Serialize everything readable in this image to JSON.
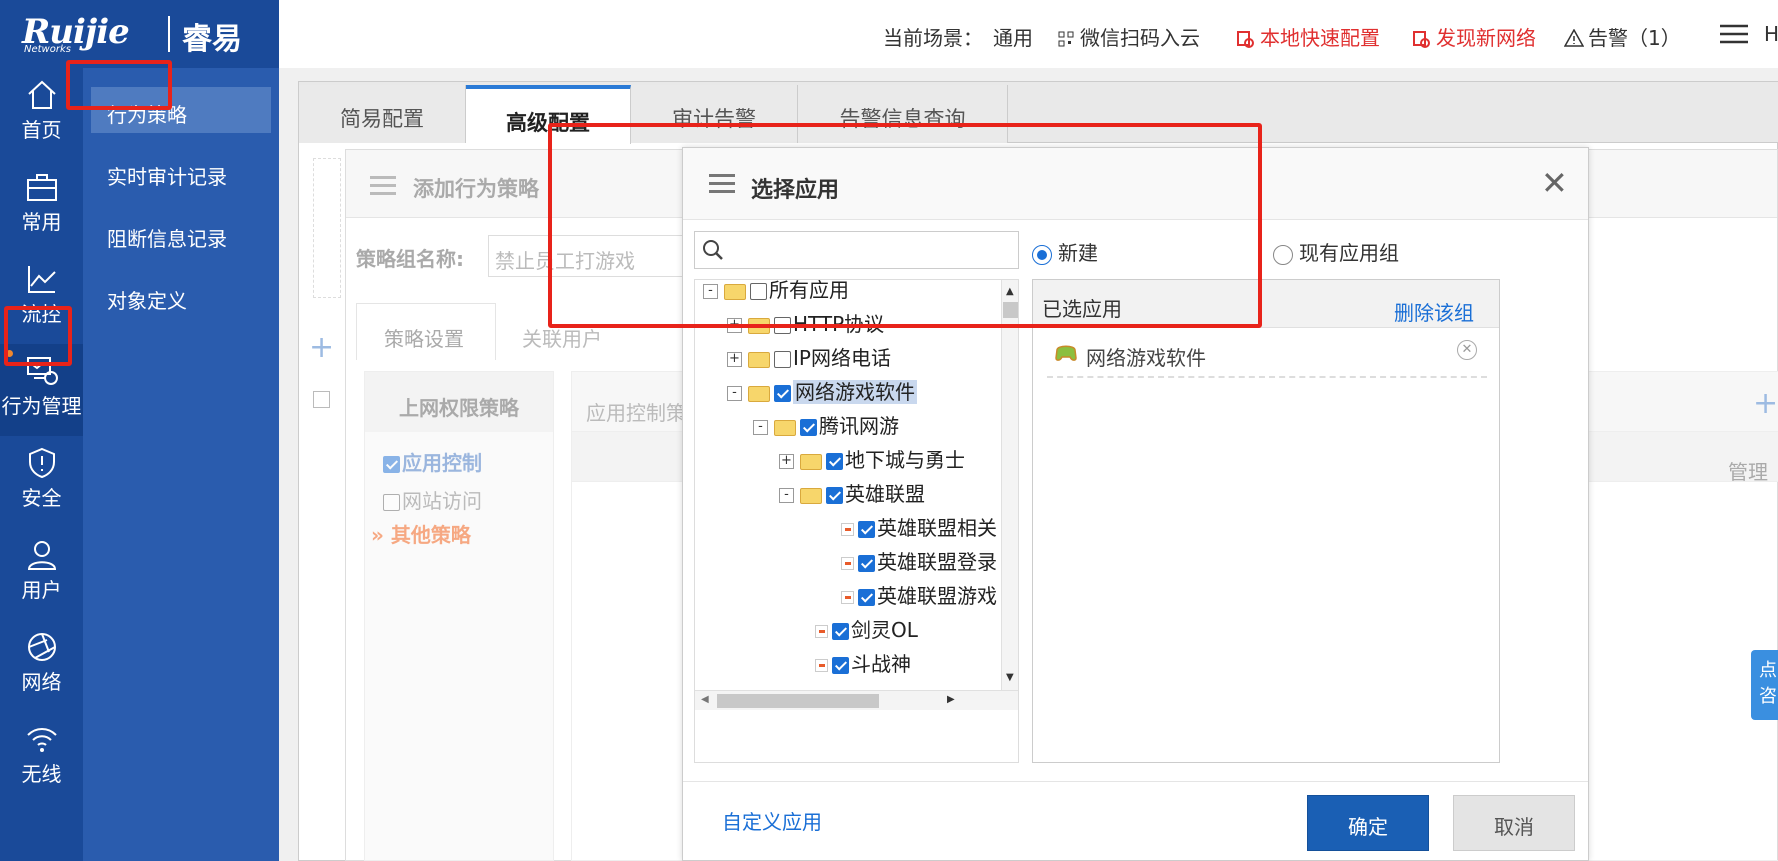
{
  "brand": {
    "logo": "Ruijie",
    "logo_sub": "Networks",
    "product": "睿易"
  },
  "topbar": {
    "scene_label": "当前场景：",
    "scene_value": "通用",
    "wechat": "微信扫码入云",
    "local_config": "本地快速配置",
    "discover": "发现新网络",
    "alarm": "告警（1）",
    "cut_text": "H"
  },
  "rail": [
    {
      "label": "首页",
      "icon": "home-icon"
    },
    {
      "label": "常用",
      "icon": "briefcase-icon"
    },
    {
      "label": "流控",
      "icon": "chart-icon"
    },
    {
      "label": "行为管理",
      "icon": "monitor-icon"
    },
    {
      "label": "安全",
      "icon": "shield-icon"
    },
    {
      "label": "用户",
      "icon": "user-icon"
    },
    {
      "label": "网络",
      "icon": "network-icon"
    },
    {
      "label": "无线",
      "icon": "wifi-icon"
    }
  ],
  "submenu": [
    "行为策略",
    "实时审计记录",
    "阻断信息记录",
    "对象定义"
  ],
  "tabs": [
    "简易配置",
    "高级配置",
    "审计告警",
    "告警信息查询"
  ],
  "bg": {
    "panel_title": "添加行为策略",
    "group_name_label": "策略组名称:",
    "group_name_value": "禁止员工打游戏",
    "subtabs": [
      "策略设置",
      "关联用户"
    ],
    "left_head": "上网权限策略",
    "opt_app": "应用控制",
    "opt_web": "网站访问",
    "opt_other": "其他策略",
    "app_ctrl_col": "应用控制策",
    "manage_col": "管理",
    "side_chars": [
      "点",
      "咨"
    ]
  },
  "dialog": {
    "title": "选择应用",
    "radio_new": "新建",
    "radio_existing": "现有应用组",
    "selected_label": "已选应用",
    "delete_group": "删除该组",
    "selected_items": [
      "网络游戏软件"
    ],
    "custom_app": "自定义应用",
    "ok": "确定",
    "cancel": "取消",
    "tree": [
      {
        "label": "所有应用",
        "toggle": "-",
        "checked": false
      },
      {
        "label": "HTTP协议",
        "toggle": "+",
        "checked": false
      },
      {
        "label": "IP网络电话",
        "toggle": "+",
        "checked": false
      },
      {
        "label": "网络游戏软件",
        "toggle": "-",
        "checked": true
      },
      {
        "label": "腾讯网游",
        "toggle": "-",
        "checked": true
      },
      {
        "label": "地下城与勇士",
        "toggle": "+",
        "checked": true
      },
      {
        "label": "英雄联盟",
        "toggle": "-",
        "checked": true
      },
      {
        "label": "英雄联盟相关",
        "checked": true
      },
      {
        "label": "英雄联盟登录",
        "checked": true
      },
      {
        "label": "英雄联盟游戏",
        "checked": true
      },
      {
        "label": "剑灵OL",
        "checked": true
      },
      {
        "label": "斗战神",
        "checked": true
      }
    ]
  }
}
